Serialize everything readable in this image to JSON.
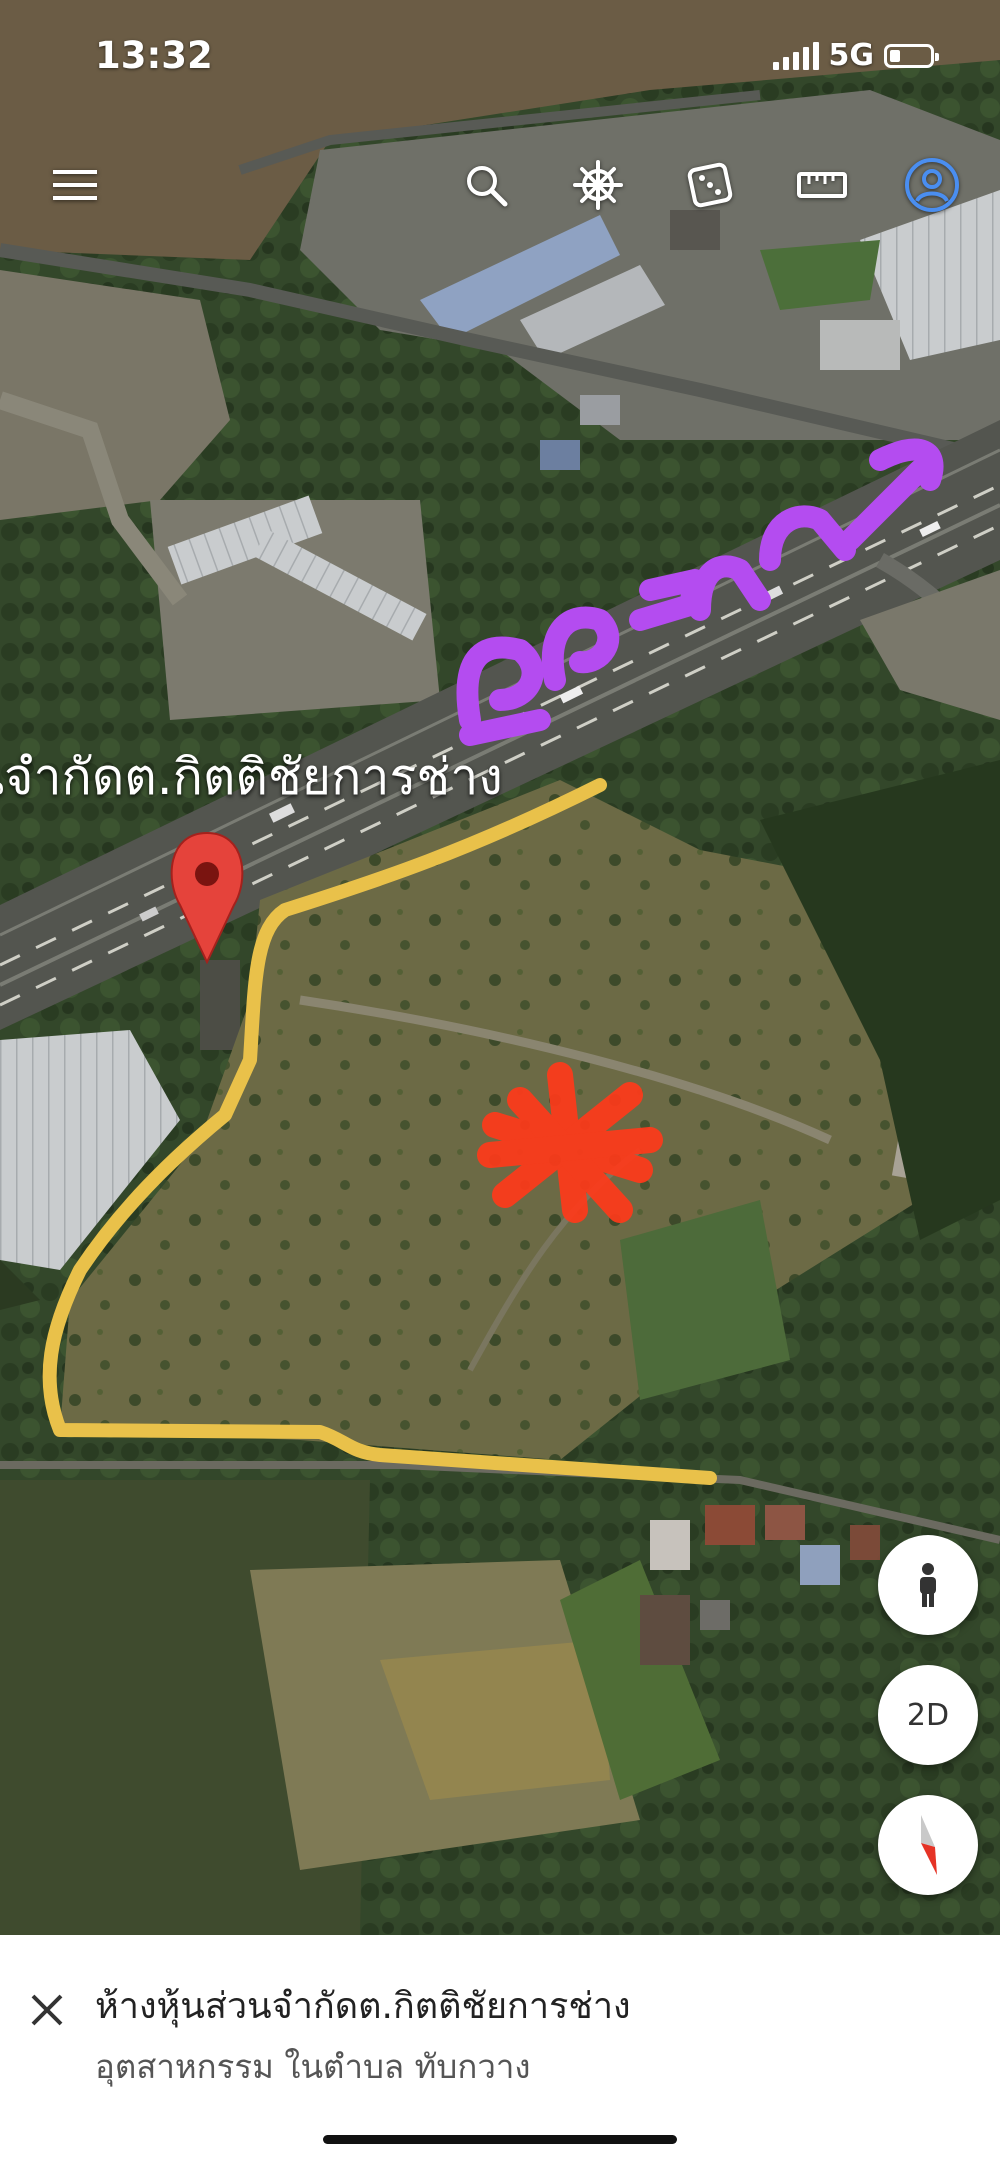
{
  "status_bar": {
    "time": "13:32",
    "network": "5G",
    "battery_level": 0.25
  },
  "toolbar": {
    "icons": [
      "menu-icon",
      "search-icon",
      "voyager-wheel-icon",
      "dice-icon",
      "ruler-icon",
      "profile-icon"
    ]
  },
  "map": {
    "place_label": "นจำกัดต.กิตติชัยการช่าง",
    "colors": {
      "route_outline": "#e9c14a",
      "handwritten_text": "#b44cf0",
      "asterisk_mark": "#ff3a1a",
      "pin": "#e5433b"
    }
  },
  "controls": {
    "street_view_icon": "pegman-icon",
    "view_mode": "2D",
    "compass_icon": "compass-icon"
  },
  "bottom_panel": {
    "title": "ห้างหุ้นส่วนจำกัดต.กิตติชัยการช่าง",
    "subtitle": "อุตสาหกรรม ในตำบล ทับกวาง"
  }
}
